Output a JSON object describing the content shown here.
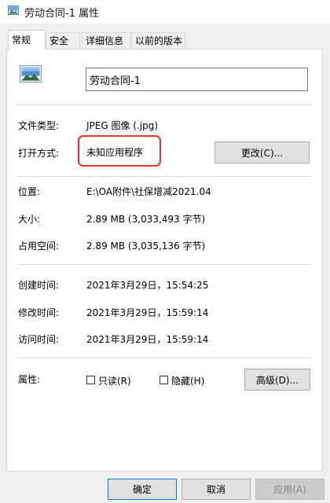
{
  "window": {
    "title": "劳动合同-1 属性"
  },
  "tabs": [
    {
      "label": "常规",
      "active": true
    },
    {
      "label": "安全",
      "active": false
    },
    {
      "label": "详细信息",
      "active": false
    },
    {
      "label": "以前的版本",
      "active": false
    }
  ],
  "file": {
    "name": "劳动合同-1",
    "icon": "image-file-icon"
  },
  "fields": {
    "type_label": "文件类型:",
    "type_value": "JPEG 图像 (.jpg)",
    "open_label": "打开方式:",
    "open_value": "未知应用程序",
    "change_button": "更改(C)...",
    "location_label": "位置:",
    "location_value": "E:\\OA附件\\社保增减2021.04",
    "size_label": "大小:",
    "size_value": "2.89 MB (3,033,493 字节)",
    "disk_label": "占用空间:",
    "disk_value": "2.89 MB (3,035,136 字节)",
    "created_label": "创建时间:",
    "created_value": "2021年3月29日，15:54:25",
    "modified_label": "修改时间:",
    "modified_value": "2021年3月29日，15:59:14",
    "accessed_label": "访问时间:",
    "accessed_value": "2021年3月29日，15:59:14",
    "attributes_label": "属性:",
    "readonly_label": "只读(R)",
    "readonly_checked": false,
    "hidden_label": "隐藏(H)",
    "hidden_checked": false,
    "advanced_button": "高级(D)..."
  },
  "footer": {
    "ok": "确定",
    "cancel": "取消",
    "apply": "应用(A)"
  },
  "colors": {
    "highlight": "#e9322f",
    "focus": "#0078d7"
  }
}
